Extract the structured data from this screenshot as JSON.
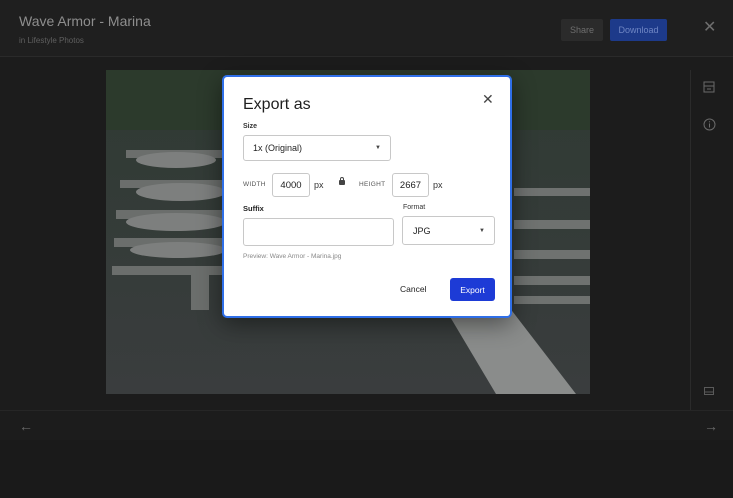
{
  "header": {
    "title": "Wave Armor - Marina",
    "subtitle": "in Lifestyle Photos",
    "share_label": "Share",
    "download_label": "Download",
    "close_glyph": "✕"
  },
  "sidebar_icons": [
    "archive-icon",
    "info-icon",
    "filmstrip-icon"
  ],
  "nav": {
    "prev_glyph": "←",
    "next_glyph": "→"
  },
  "modal": {
    "title": "Export as",
    "close_glyph": "✕",
    "size_label": "Size",
    "size_value": "1x (Original)",
    "width_label": "WIDTH",
    "width_value": "4000",
    "width_unit": "px",
    "height_label": "HEIGHT",
    "height_value": "2667",
    "height_unit": "px",
    "suffix_label": "Suffix",
    "suffix_value": "",
    "format_label": "Format",
    "format_value": "JPG",
    "preview_text": "Preview: Wave Armor - Marina.jpg",
    "cancel_label": "Cancel",
    "export_label": "Export"
  },
  "colors": {
    "accent": "#1d3bd6",
    "modal_border": "#2f6fe8",
    "background": "#1c1c1c"
  }
}
